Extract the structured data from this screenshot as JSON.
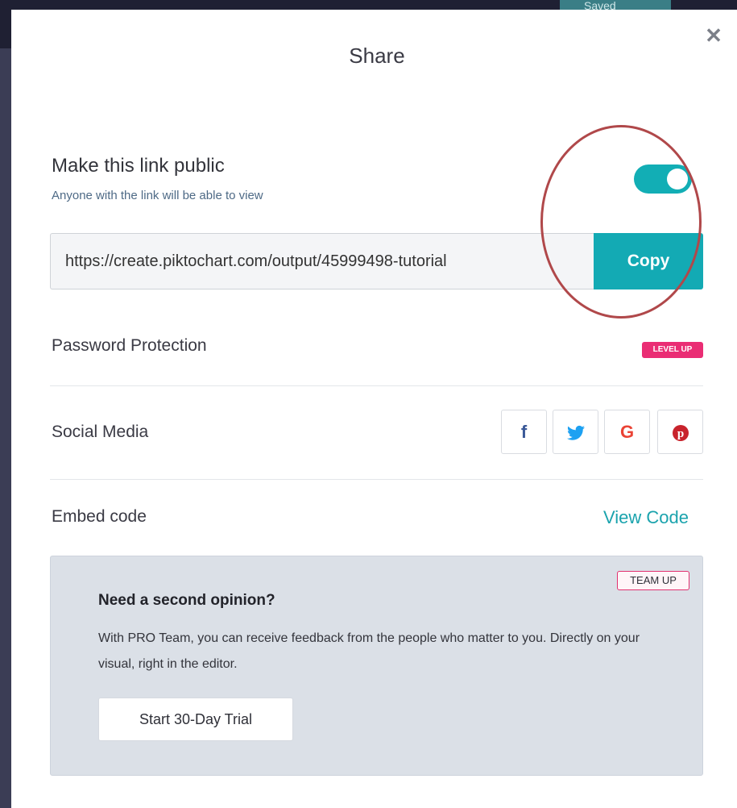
{
  "backdrop": {
    "saved_label": "Saved"
  },
  "modal": {
    "title": "Share",
    "close_glyph": "✕"
  },
  "public_link": {
    "title": "Make this link public",
    "subtitle": "Anyone with the link will be able to view",
    "toggle_on": true,
    "url": "https://create.piktochart.com/output/45999498-tutorial",
    "copy_label": "Copy"
  },
  "password": {
    "label": "Password Protection",
    "badge": "LEVEL UP"
  },
  "social": {
    "label": "Social Media",
    "buttons": [
      {
        "icon": "facebook-icon",
        "glyph": "f",
        "color": "#3b5998"
      },
      {
        "icon": "twitter-icon",
        "glyph": "🐦",
        "color": "#1da1f2"
      },
      {
        "icon": "google-icon",
        "glyph": "G",
        "color": "#ea4335"
      },
      {
        "icon": "pinterest-icon",
        "glyph": "℗",
        "color": "#e60023"
      }
    ]
  },
  "embed": {
    "label": "Embed code",
    "link": "View Code"
  },
  "promo": {
    "badge": "TEAM UP",
    "title": "Need a second opinion?",
    "text": "With PRO Team, you can receive feedback from the people who matter to you. Directly on your visual, right in the editor.",
    "cta": "Start 30-Day Trial"
  },
  "colors": {
    "accent": "#13aab4",
    "badge_pink": "#ea2d74",
    "highlight": "#b0484a"
  }
}
